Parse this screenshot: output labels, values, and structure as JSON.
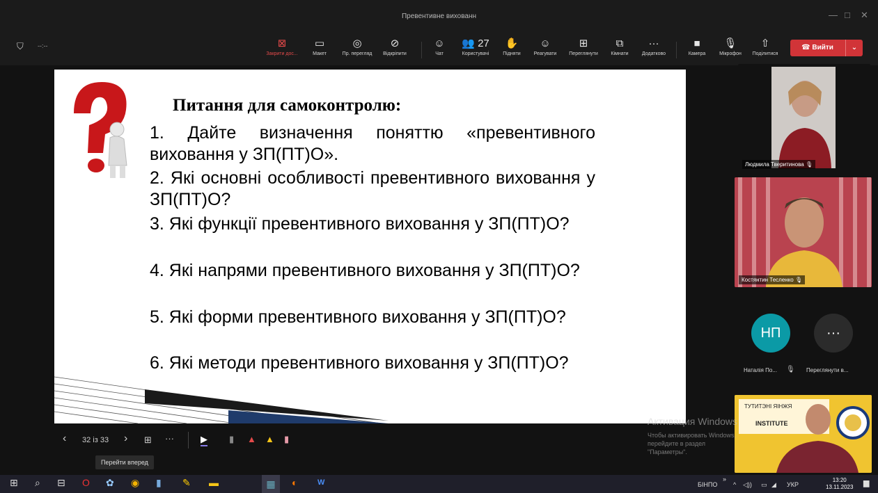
{
  "window": {
    "title": "Превентивне вихованн",
    "minimize": "—",
    "maximize": "□",
    "close": "✕"
  },
  "status": {
    "timer": "--:--"
  },
  "toolbar": [
    {
      "id": "stop-share",
      "icon": "⊠",
      "label": "Закрити дос...",
      "red": true
    },
    {
      "id": "layout",
      "icon": "▭",
      "label": "Макет"
    },
    {
      "id": "presenter-view",
      "icon": "◎",
      "label": "Пр. перегляд"
    },
    {
      "id": "unpin",
      "icon": "⊘",
      "label": "Відкріпити"
    },
    {
      "id": "chat",
      "icon": "☺",
      "label": "Чат"
    },
    {
      "id": "users",
      "icon": "👥 27",
      "label": "Користувачі"
    },
    {
      "id": "raise-hand",
      "icon": "✋",
      "label": "Підняти"
    },
    {
      "id": "react",
      "icon": "☺",
      "label": "Реагувати"
    },
    {
      "id": "view",
      "icon": "⊞",
      "label": "Переглянути"
    },
    {
      "id": "rooms",
      "icon": "⧉",
      "label": "Кімнати"
    },
    {
      "id": "more",
      "icon": "···",
      "label": "Додатково"
    },
    {
      "id": "camera",
      "icon": "■",
      "label": "Камера"
    },
    {
      "id": "mic",
      "icon": "🎙",
      "label": "Мікрофон"
    },
    {
      "id": "share",
      "icon": "⇧",
      "label": "Поділитися"
    }
  ],
  "leave": {
    "label": "Вийти",
    "phone": "☎",
    "chevron": "⌄"
  },
  "slide": {
    "title": "Питання для  самоконтролю:",
    "questions": [
      "1. Дайте визначення поняттю «превентивного виховання у ЗП(ПТ)О».",
      "2. Які основні особливості превентивного виховання у ЗП(ПТ)О?",
      "3. Які функції превентивного виховання у ЗП(ПТ)О?",
      "4. Які напрями превентивного виховання у ЗП(ПТ)О?",
      "5. Які форми превентивного виховання у ЗП(ПТ)О?",
      "6. Які методи превентивного виховання у ЗП(ПТ)О?"
    ]
  },
  "slide_controls": {
    "prev": "‹",
    "page": "32 із 33",
    "next": "›",
    "grid": "⊞",
    "more": "···",
    "pointer": "▶",
    "pen": "▮",
    "highlighter": "▲",
    "marker": "▲",
    "eraser": "▮",
    "tooltip": "Перейти вперед"
  },
  "participants": {
    "p1": {
      "name": "Людмила Тверитинова"
    },
    "p2": {
      "name": "Костянтин Тесленко"
    },
    "p3": {
      "initials": "НП",
      "name": "Наталія По..."
    },
    "more": {
      "icon": "···",
      "label": "Переглянути в..."
    },
    "p4": {
      "banner1": "ТУТИТЭНІ ЯІНЖЯ",
      "banner2": "INSTITUTE"
    }
  },
  "watermark": {
    "line1": "Активация Windows",
    "line2": "Чтобы активировать Windows, перейдите в раздел \"Параметры\"."
  },
  "taskbar": {
    "icons": [
      "⊞",
      "⌕",
      "⊟",
      "O",
      "✿",
      "◉",
      "▮",
      "✎",
      "▬",
      "▦",
      "◐",
      "W"
    ],
    "tray": {
      "lang_label": "БІНПО",
      "chevron": "»",
      "up": "^",
      "vol": "◁))",
      "keyboard": "▭",
      "lang": "УКР",
      "time": "13:20",
      "date": "13.11.2023",
      "notify": "▆"
    }
  },
  "colors": {
    "accent": "#d13438",
    "avatar": "#0b9aa6",
    "app_bg": "#121212"
  }
}
